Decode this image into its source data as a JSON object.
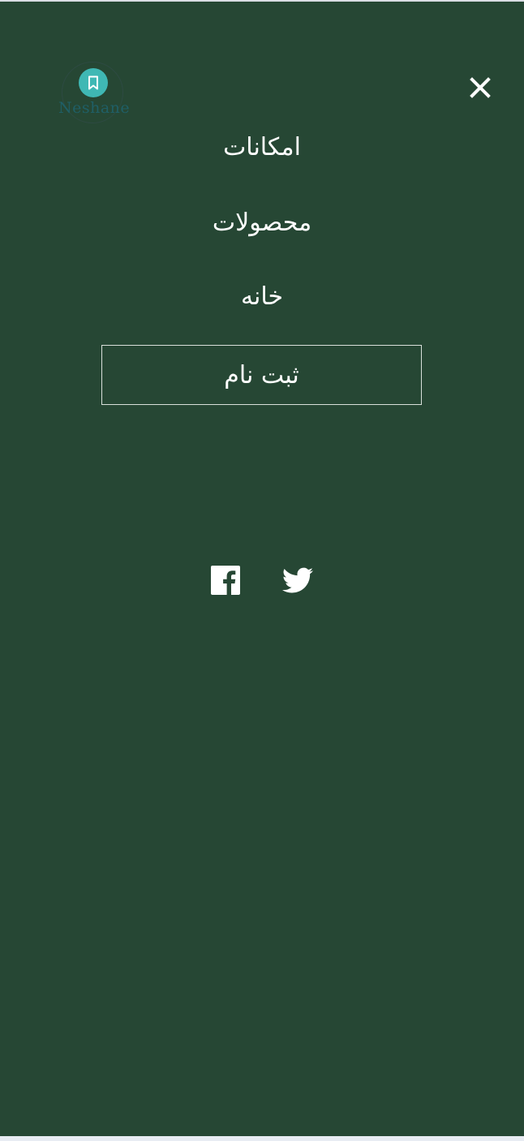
{
  "brand": {
    "name": "Neshane"
  },
  "menu": {
    "items": [
      {
        "label": "امکانات"
      },
      {
        "label": "محصولات"
      },
      {
        "label": "خانه"
      }
    ],
    "signup_label": "ثبت نام"
  },
  "icons": {
    "close": "close-icon",
    "facebook": "facebook-icon",
    "twitter": "twitter-icon",
    "logo": "bookmark-icon"
  },
  "colors": {
    "panel_background": "#264734",
    "text": "#ffffff",
    "logo_accent": "#3fb8b4",
    "logo_text": "#1f5f66",
    "page_background": "#e8ecf3"
  }
}
